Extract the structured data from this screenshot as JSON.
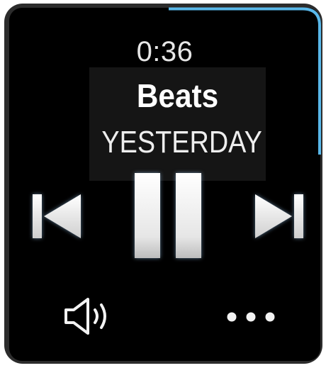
{
  "player": {
    "elapsed_time": "0:36",
    "artist": "Beats",
    "track_title": "YESTERDAY"
  },
  "controls": {
    "previous": "skip-previous-icon",
    "play_pause": "pause-icon",
    "next": "skip-next-icon",
    "volume": "volume-speaker-icon",
    "more": "more-options-icon"
  },
  "colors": {
    "accent": "#59b8ea",
    "bezel": "#2c2c2c",
    "screen": "#000000",
    "icon": "#f2f2f2"
  }
}
